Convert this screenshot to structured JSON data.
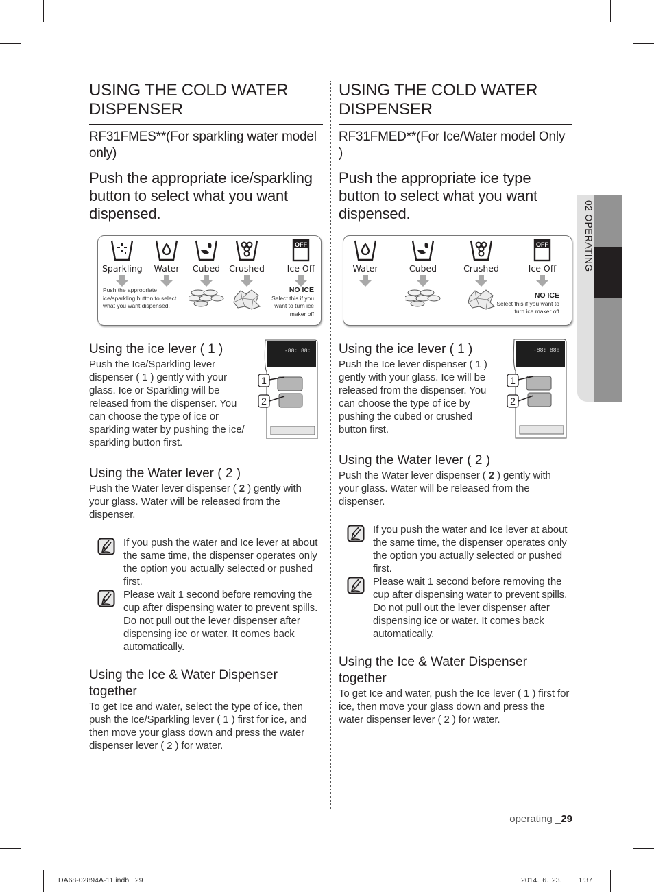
{
  "left": {
    "title": "USING THE COLD WATER DISPENSER",
    "model": "RF31FMES**(For sparkling water model only)",
    "instruction": "Push the appropriate ice/sparkling button to select what you want dispensed.",
    "panel": {
      "buttons": [
        {
          "label": "Sparkling",
          "icon": "sparkling-glass-icon"
        },
        {
          "label": "Water",
          "icon": "water-glass-icon"
        },
        {
          "label": "Cubed",
          "icon": "cubed-glass-icon"
        },
        {
          "label": "Crushed",
          "icon": "crushed-glass-icon"
        },
        {
          "label": "Ice Off",
          "icon": "ice-off-icon"
        }
      ],
      "off_badge": "OFF",
      "note": "Push the appropriate ice/sparkling button to select what you want dispensed.",
      "no_ice_title": "NO ICE",
      "no_ice_text": "Select this if you want to turn ice maker off"
    },
    "ice_lever": {
      "heading": "Using the ice lever ( 1 )",
      "text": "Push the Ice/Sparkling lever dispenser ( 1 ) gently with your glass. Ice or Sparkling will be released from the dispenser. You can choose the type of ice or sparkling water by pushing the ice/ sparkling button first."
    },
    "water_lever": {
      "heading": "Using the Water lever ( 2 )",
      "text_before": "Push the Water lever dispenser ( ",
      "text_bold": "2",
      "text_after": " ) gently with your glass. Water will be released from the dispenser."
    },
    "notes": [
      "If you push the water and Ice lever at about the same time, the dispenser operates only the option you actually selected or pushed first.",
      "Please wait 1 second before removing the cup after dispensing water to prevent spills. Do not pull out the lever dispenser after dispensing ice or water. It comes back automatically."
    ],
    "together": {
      "heading": "Using the Ice & Water Dispenser together",
      "text": "To get Ice and water, select the type of ice, then push the Ice/Sparkling lever ( 1 ) first for ice, and then move your glass down and press the water dispenser lever ( 2 ) for water."
    },
    "figure_callouts": [
      "1",
      "2"
    ]
  },
  "right": {
    "title": "USING THE COLD WATER DISPENSER",
    "model": "RF31FMED**(For Ice/Water model Only )",
    "instruction": "Push the appropriate ice type button to select what you want dispensed.",
    "panel": {
      "buttons": [
        {
          "label": "Water",
          "icon": "water-glass-icon"
        },
        {
          "label": "Cubed",
          "icon": "cubed-glass-icon"
        },
        {
          "label": "Crushed",
          "icon": "crushed-glass-icon"
        },
        {
          "label": "Ice Off",
          "icon": "ice-off-icon"
        }
      ],
      "off_badge": "OFF",
      "no_ice_title": "NO ICE",
      "no_ice_text": "Select this if you want to turn ice maker off"
    },
    "ice_lever": {
      "heading": "Using the ice lever ( 1 )",
      "text": "Push the Ice lever dispenser ( 1 ) gently with your glass. Ice will be released from the dispenser. You can choose the type of ice by pushing the cubed or crushed button first."
    },
    "water_lever": {
      "heading": "Using the Water lever ( 2 )",
      "text_before": "Push the Water lever dispenser ( ",
      "text_bold": "2",
      "text_after": " ) gently with your glass. Water will be released from the dispenser."
    },
    "notes": [
      "If you push the water and Ice lever at about the same time, the dispenser operates only the option you actually selected or pushed first.",
      "Please wait 1 second before removing the cup after dispensing water to prevent spills. Do not pull out the lever dispenser after dispensing ice or water. It comes back automatically."
    ],
    "together": {
      "heading": "Using the Ice & Water Dispenser together",
      "text": "To get Ice and water, push the Ice lever ( 1 ) first for ice, then move your glass down and press the water dispenser lever ( 2 ) for water."
    },
    "figure_callouts": [
      "1",
      "2"
    ]
  },
  "side_tab": {
    "label": "02  OPERATING"
  },
  "page_number": {
    "prefix": "operating _",
    "number": "29"
  },
  "footer": {
    "file": "DA68-02894A-11.indb   29",
    "date": "2014. 6. 23.",
    "time": "1:37"
  },
  "colors": {
    "text": "#231f20",
    "tab_light": "#e0e0e0",
    "tab_gray": "#939393",
    "tab_dark": "#231f20",
    "arrow": "#a9a9a9"
  }
}
